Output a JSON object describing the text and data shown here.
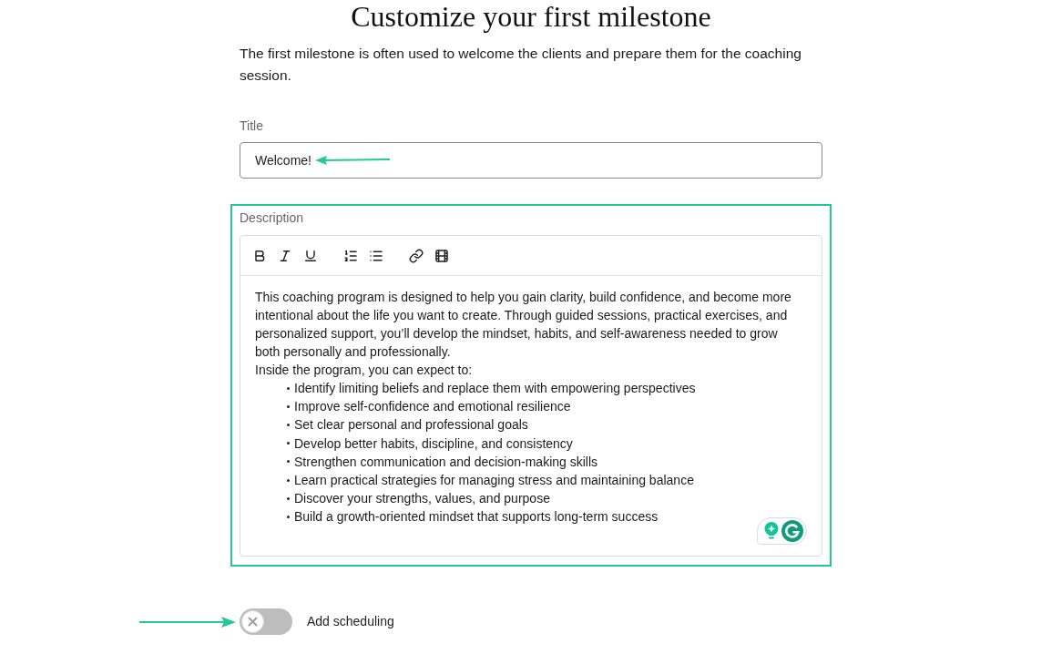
{
  "header": {
    "title": "Customize your first milestone",
    "intro": "The first milestone is often used to welcome the clients and prepare them for the coaching session."
  },
  "title_field": {
    "label": "Title",
    "value": "Welcome!"
  },
  "description_field": {
    "label": "Description",
    "paragraph": "This coaching program is designed to help you gain clarity, build confidence, and become more intentional about the life you want to create. Through guided sessions, practical exercises, and personalized support, you’ll develop the mindset, habits, and self-awareness needed to grow both personally and professionally.",
    "list_intro": "Inside the program, you can expect to:",
    "bullets": [
      "Identify limiting beliefs and replace them with empowering perspectives",
      "Improve self-confidence and emotional resilience",
      "Set clear personal and professional goals",
      "Develop better habits, discipline, and consistency",
      "Strengthen communication and decision-making skills",
      "Learn practical strategies for managing stress and maintaining balance",
      "Discover your strengths, values, and purpose",
      "Build a growth-oriented mindset that supports long-term success"
    ]
  },
  "scheduling": {
    "label": "Add scheduling",
    "on": false
  }
}
